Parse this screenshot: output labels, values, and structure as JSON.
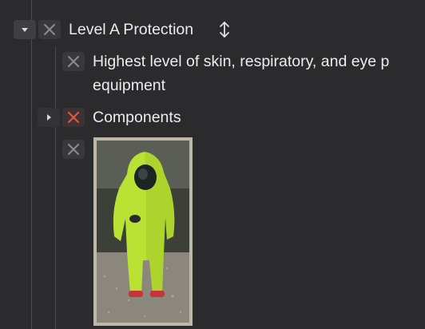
{
  "outline": {
    "level_a": {
      "title": "Level A Protection",
      "expanded": true,
      "sort_icon": "sort-updown-icon",
      "children": {
        "description": {
          "line1": "Highest level of skin,  respiratory, and eye  p",
          "line2": "equipment"
        },
        "components": {
          "label": "Components",
          "expanded": false,
          "checkbox_state": "marked-red"
        },
        "image": {
          "depicts": "level-a-protective-suit-photo"
        }
      }
    }
  },
  "colors": {
    "background": "#2b2b2e",
    "text": "#ececec",
    "checkbox_mark": "#8a8a8f",
    "checkbox_mark_red": "#e4553a"
  }
}
